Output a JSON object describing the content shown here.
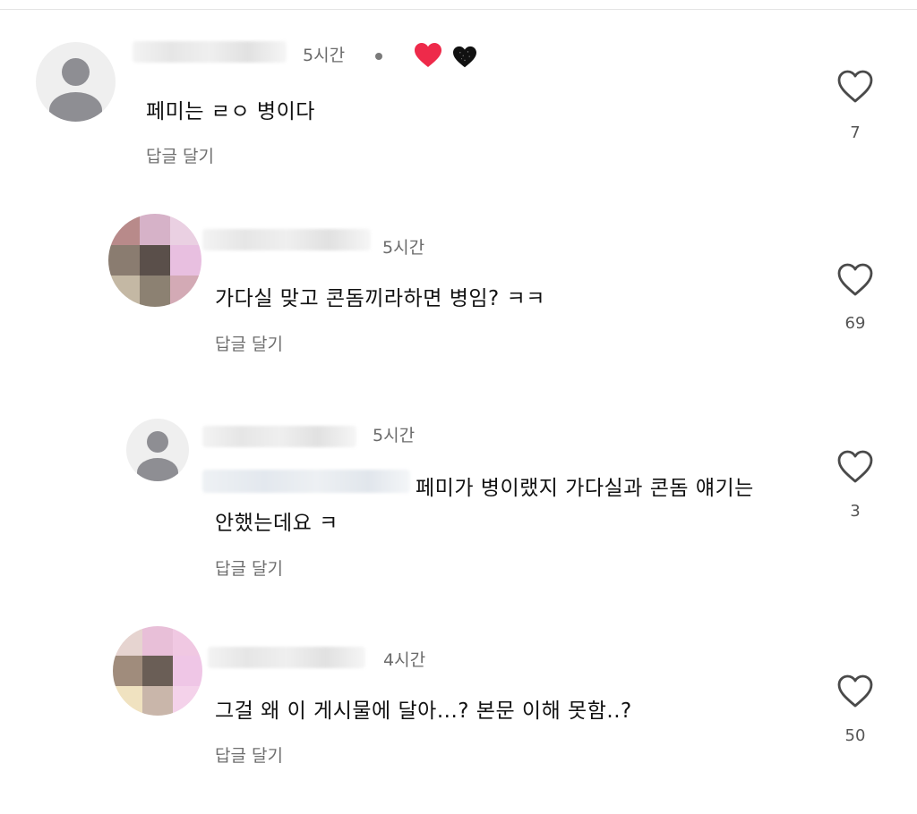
{
  "colors": {
    "time": "#6b6b6b",
    "reply": "#6f6f6f",
    "like_outline": "#4a4a4a",
    "heart_red": "#ee2a4a",
    "heart_black": "#111111"
  },
  "comments": [
    {
      "avatar": "default-avatar",
      "time": "5시간",
      "badges": [
        "red-heart-icon",
        "black-heart-icon"
      ],
      "text": "페미는 ㄹㅇ 병이다",
      "reply_label": "답글 달기",
      "likes": "7"
    },
    {
      "avatar": "pixelated-avatar",
      "time": "5시간",
      "text": "가다실 맞고 콘돔끼라하면 병임? ㅋㅋ",
      "reply_label": "답글 달기",
      "likes": "69"
    },
    {
      "avatar": "default-avatar",
      "time": "5시간",
      "text_line1": "페미가 병이랬지 가다실과 콘돔 얘기는",
      "text_line2": "안했는데요 ㅋ",
      "reply_label": "답글 달기",
      "likes": "3"
    },
    {
      "avatar": "pixelated-avatar",
      "time": "4시간",
      "text": "그걸 왜 이 게시물에 달아...? 본문 이해 못함..?",
      "reply_label": "답글 달기",
      "likes": "50"
    }
  ]
}
